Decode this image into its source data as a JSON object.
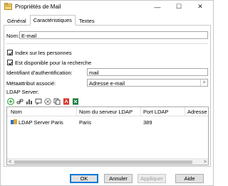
{
  "window": {
    "title": "Propriétés de Mail",
    "controls": {
      "minimize": "—",
      "maximize": "☐",
      "close": "✕"
    }
  },
  "tabs": [
    {
      "label": "Général",
      "active": false
    },
    {
      "label": "Caractéristiques",
      "active": true
    },
    {
      "label": "Textes",
      "active": false
    }
  ],
  "form": {
    "name_label": "Nom:",
    "name_value": "E-mail",
    "index_label": "Index sur les personnes",
    "index_checked": true,
    "search_label": "Est disponible pour la recherche",
    "search_checked": true,
    "auth_label": "Identifiant d'authentification:",
    "auth_value": "mail",
    "meta_label": "Métaattribut associé:",
    "meta_value": "Adresse e-mail",
    "ldap_label": "LDAP Server:"
  },
  "toolbar_icons": [
    "add-icon",
    "link-icon",
    "chart-icon",
    "comment-icon",
    "remove-icon",
    "copy-icon",
    "pdf-icon",
    "excel-icon"
  ],
  "table": {
    "columns": [
      "Nom",
      "Nom du serveur LDAP",
      "Port LDAP",
      "Adresse ra"
    ],
    "rows": [
      {
        "name": "LDAP Server Paris",
        "server": "Paris",
        "port": "389",
        "address": ""
      }
    ]
  },
  "buttons": {
    "ok": "OK",
    "cancel": "Annuler",
    "apply": "Appliquer",
    "help": "Aide"
  },
  "colors": {
    "accent": "#0078d7",
    "add": "#2e9e3a",
    "pdf": "#d9342b",
    "excel": "#1d7d3f"
  }
}
